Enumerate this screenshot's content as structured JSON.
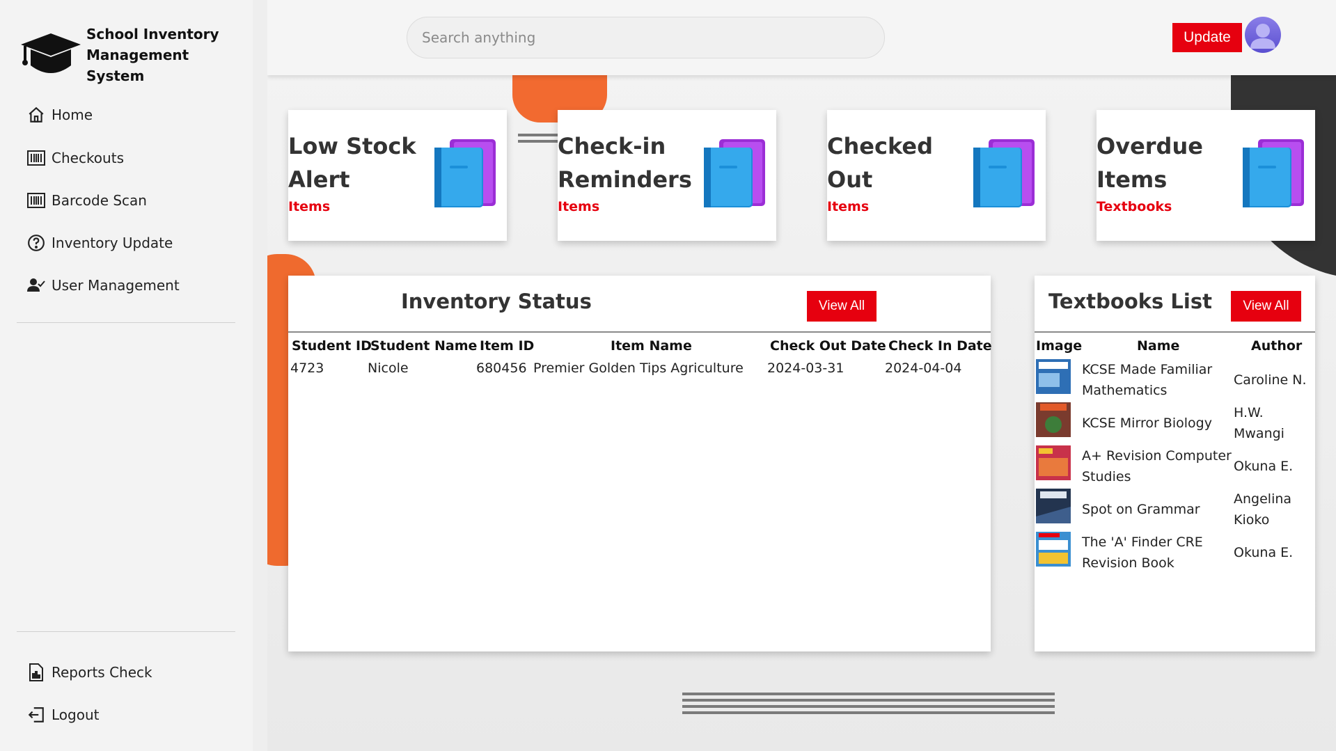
{
  "app": {
    "title_line1": "School Inventory",
    "title_line2": "Management",
    "title_line3": "System"
  },
  "sidebar": {
    "items": [
      {
        "label": "Home",
        "icon": "home-icon"
      },
      {
        "label": "Checkouts",
        "icon": "barcode-icon"
      },
      {
        "label": "Barcode Scan",
        "icon": "barcode-icon"
      },
      {
        "label": "Inventory Update",
        "icon": "help-circle-icon"
      },
      {
        "label": "User Management",
        "icon": "user-check-icon"
      }
    ],
    "bottom_items": [
      {
        "label": "Reports Check",
        "icon": "report-icon"
      },
      {
        "label": "Logout",
        "icon": "logout-icon"
      }
    ]
  },
  "topbar": {
    "search_placeholder": "Search anything",
    "update_label": "Update"
  },
  "cards": [
    {
      "title_line1": "Low Stock",
      "title_line2": "Alert",
      "sub": "Items"
    },
    {
      "title_line1": "Check-in",
      "title_line2": "Reminders",
      "sub": "Items"
    },
    {
      "title_line1": "Checked",
      "title_line2": "Out",
      "sub": "Items"
    },
    {
      "title_line1": "Overdue",
      "title_line2": "Items",
      "sub": "Textbooks"
    }
  ],
  "inventory": {
    "title": "Inventory Status",
    "view_all": "View All",
    "columns": [
      "Student ID",
      "Student Name",
      "Item ID",
      "Item Name",
      "Check Out Date",
      "Check In Date"
    ],
    "rows": [
      [
        "4723",
        "Nicole",
        "680456",
        "Premier Golden Tips Agriculture",
        "2024-03-31",
        "2024-04-04"
      ]
    ]
  },
  "textbooks": {
    "title": "Textbooks List",
    "view_all": "View All",
    "columns": [
      "Image",
      "Name",
      "Author"
    ],
    "rows": [
      {
        "name": "KCSE Made Familiar Mathematics",
        "author": "Caroline N.",
        "cover": "#2e6fb5"
      },
      {
        "name": "KCSE Mirror Biology",
        "author": "H.W. Mwangi",
        "cover": "#7a3b2e"
      },
      {
        "name": "A+ Revision Computer Studies",
        "author": "Okuna E.",
        "cover": "#c8324a"
      },
      {
        "name": "Spot on Grammar",
        "author": "Angelina Kioko",
        "cover": "#23344f"
      },
      {
        "name": "The 'A' Finder CRE Revision Book",
        "author": "Okuna E.",
        "cover": "#3b8fd1"
      }
    ]
  },
  "colors": {
    "accent": "#e6000f",
    "orange": "#ef6a2e",
    "sidebar_bg": "#f3f3f3"
  }
}
